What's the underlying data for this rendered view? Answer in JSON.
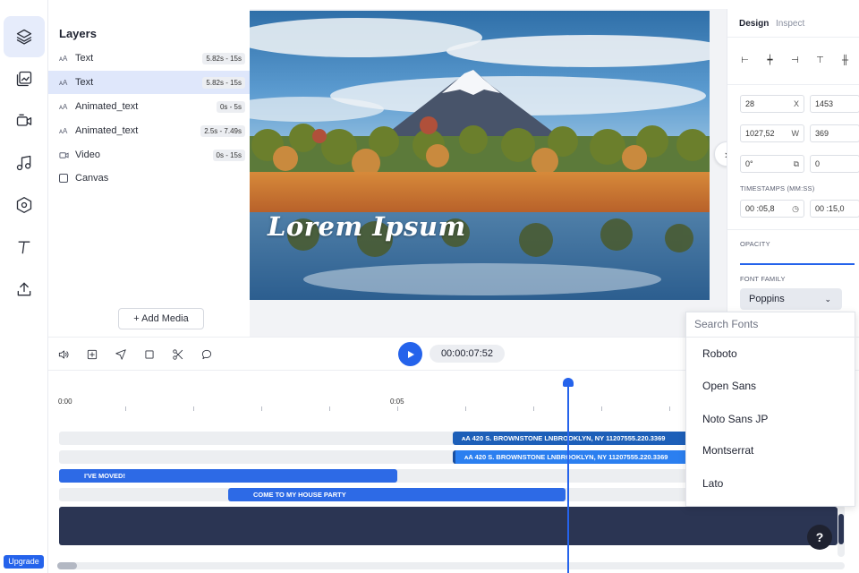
{
  "layers": {
    "title": "Layers",
    "items": [
      {
        "icon": "text-layer-icon",
        "name": "Text",
        "time": "5.82s - 15s",
        "selected": false
      },
      {
        "icon": "text-layer-icon",
        "name": "Text",
        "time": "5.82s - 15s",
        "selected": true
      },
      {
        "icon": "text-layer-icon",
        "name": "Animated_text",
        "time": "0s - 5s",
        "selected": false
      },
      {
        "icon": "text-layer-icon",
        "name": "Animated_text",
        "time": "2.5s - 7.49s",
        "selected": false
      },
      {
        "icon": "video-layer-icon",
        "name": "Video",
        "time": "0s - 15s",
        "selected": false
      },
      {
        "icon": "checkbox-icon",
        "name": "Canvas",
        "time": "",
        "selected": false
      }
    ],
    "add_media": "+ Add Media"
  },
  "canvas": {
    "overlay_text": "Lorem Ipsum"
  },
  "design": {
    "tab_design": "Design",
    "tab_inspect": "Inspect",
    "x": "28",
    "x_suffix": "X",
    "y": "1453",
    "w": "1027,52",
    "w_suffix": "W",
    "h": "369",
    "rotation": "0°",
    "radius": "0",
    "timestamps_label": "TIMESTAMPS (MM:SS)",
    "start": "00 :05,8",
    "end": "00 :15,0",
    "opacity_label": "OPACITY",
    "font_family_label": "FONT FAMILY",
    "font_family": "Poppins"
  },
  "font_dropdown": {
    "search_placeholder": "Search Fonts",
    "options": [
      "Roboto",
      "Open Sans",
      "Noto Sans JP",
      "Montserrat",
      "Lato"
    ]
  },
  "toolbar": {
    "timecode": "00:00:07:52"
  },
  "timeline": {
    "ruler": [
      "0:00",
      "0:05"
    ],
    "clips": {
      "address_1": "ᴀA  420 S. BROWNSTONE LNBROOKLYN, NY 11207555.220.3369",
      "address_2": "ᴀA  420 S. BROWNSTONE LNBROOKLYN, NY 11207555.220.3369",
      "moved": "I'VE MOVED!",
      "party": "COME TO MY HOUSE PARTY"
    }
  },
  "sidebar": {
    "upgrade": "Upgrade"
  },
  "colors": {
    "accent": "#2563eb",
    "video_track": "#2b3553",
    "selected_row": "#dfe7fb"
  }
}
